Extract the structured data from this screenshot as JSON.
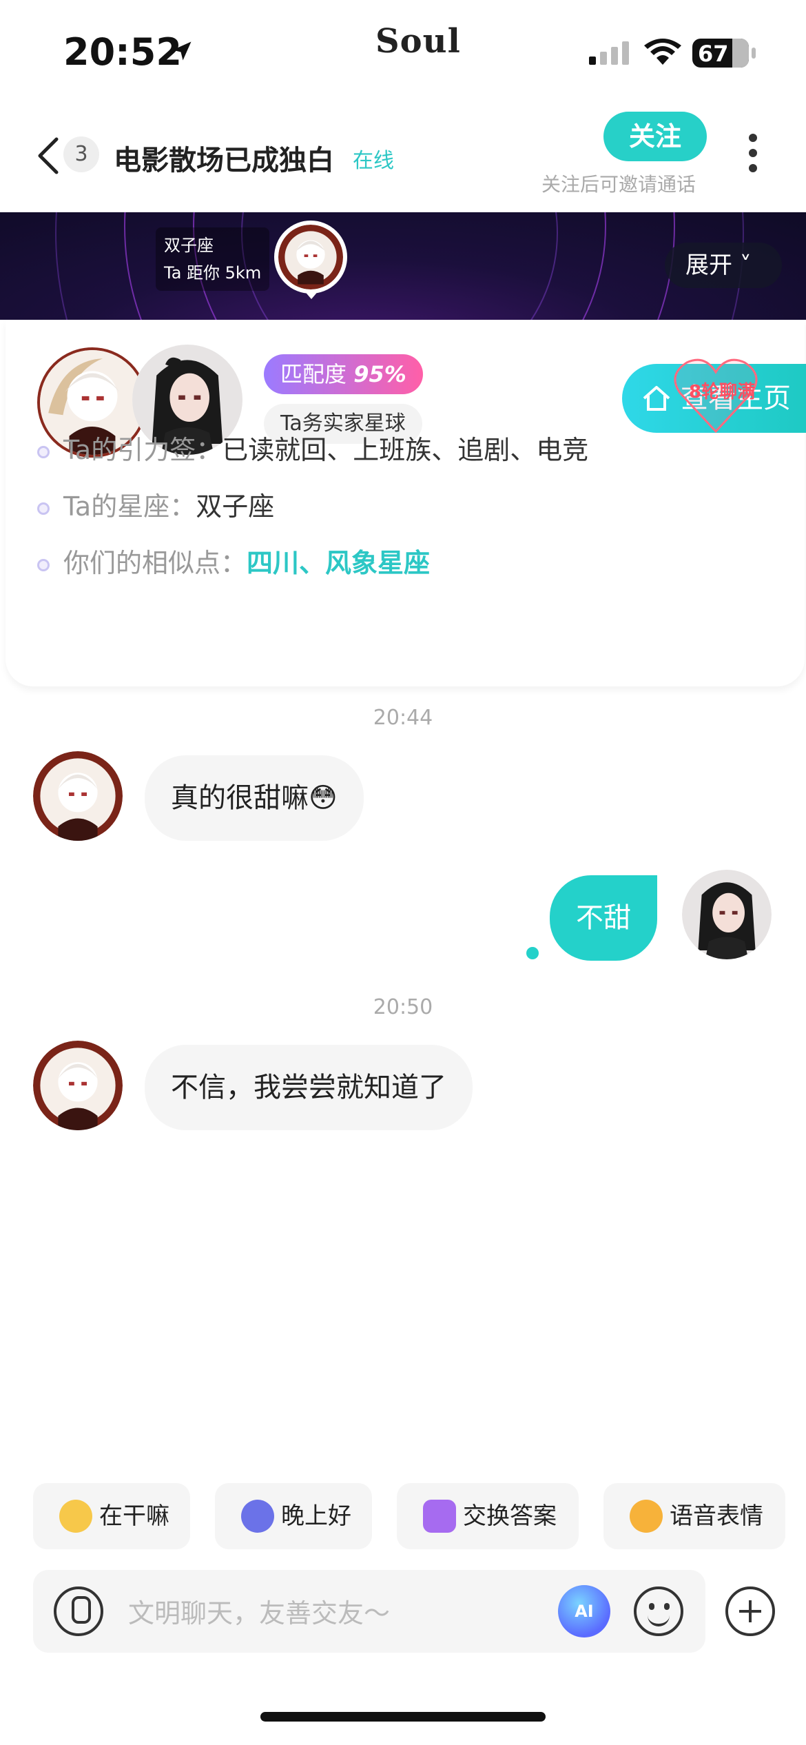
{
  "status_bar": {
    "time": "20:52",
    "brand": "Soul",
    "battery": "67"
  },
  "header": {
    "unread_count": "3",
    "title": "电影散场已成独白",
    "online": "在线",
    "follow_label": "关注",
    "follow_hint": "关注后可邀请通话"
  },
  "banner": {
    "zodiac": "双子座",
    "distance": "Ta 距你 5km",
    "expand_label": "展开 ˅"
  },
  "card": {
    "match_label": "匹配度",
    "match_value": "95%",
    "planet": "Ta务实家星球",
    "home_label": "查看主页",
    "heart_label": "8轮聊满",
    "rows": [
      {
        "label": "Ta的引力签：",
        "value": "已读就回、上班族、追剧、电竞"
      },
      {
        "label": "Ta的星座：",
        "value": "双子座"
      },
      {
        "label": "你们的相似点：",
        "value": "四川、风象星座"
      }
    ]
  },
  "chat": {
    "messages": [
      {
        "time": "20:44"
      },
      {
        "from": "them",
        "text": "真的很甜嘛😳"
      },
      {
        "from": "me",
        "text": "不甜"
      },
      {
        "time": "20:50"
      },
      {
        "from": "them",
        "text": "不信，我尝尝就知道了"
      }
    ]
  },
  "quick_replies": [
    {
      "label": "在干嘛",
      "icon": "face-icon",
      "color": "#f7c84a"
    },
    {
      "label": "晚上好",
      "icon": "moon-icon",
      "color": "#6b72e8"
    },
    {
      "label": "交换答案",
      "icon": "swap-icon",
      "color": "#a66bf0"
    },
    {
      "label": "语音表情",
      "icon": "voice-emoji-icon",
      "color": "#f7b23a"
    }
  ],
  "input": {
    "placeholder": "文明聊天，友善交友～",
    "ai_label": "AI"
  }
}
